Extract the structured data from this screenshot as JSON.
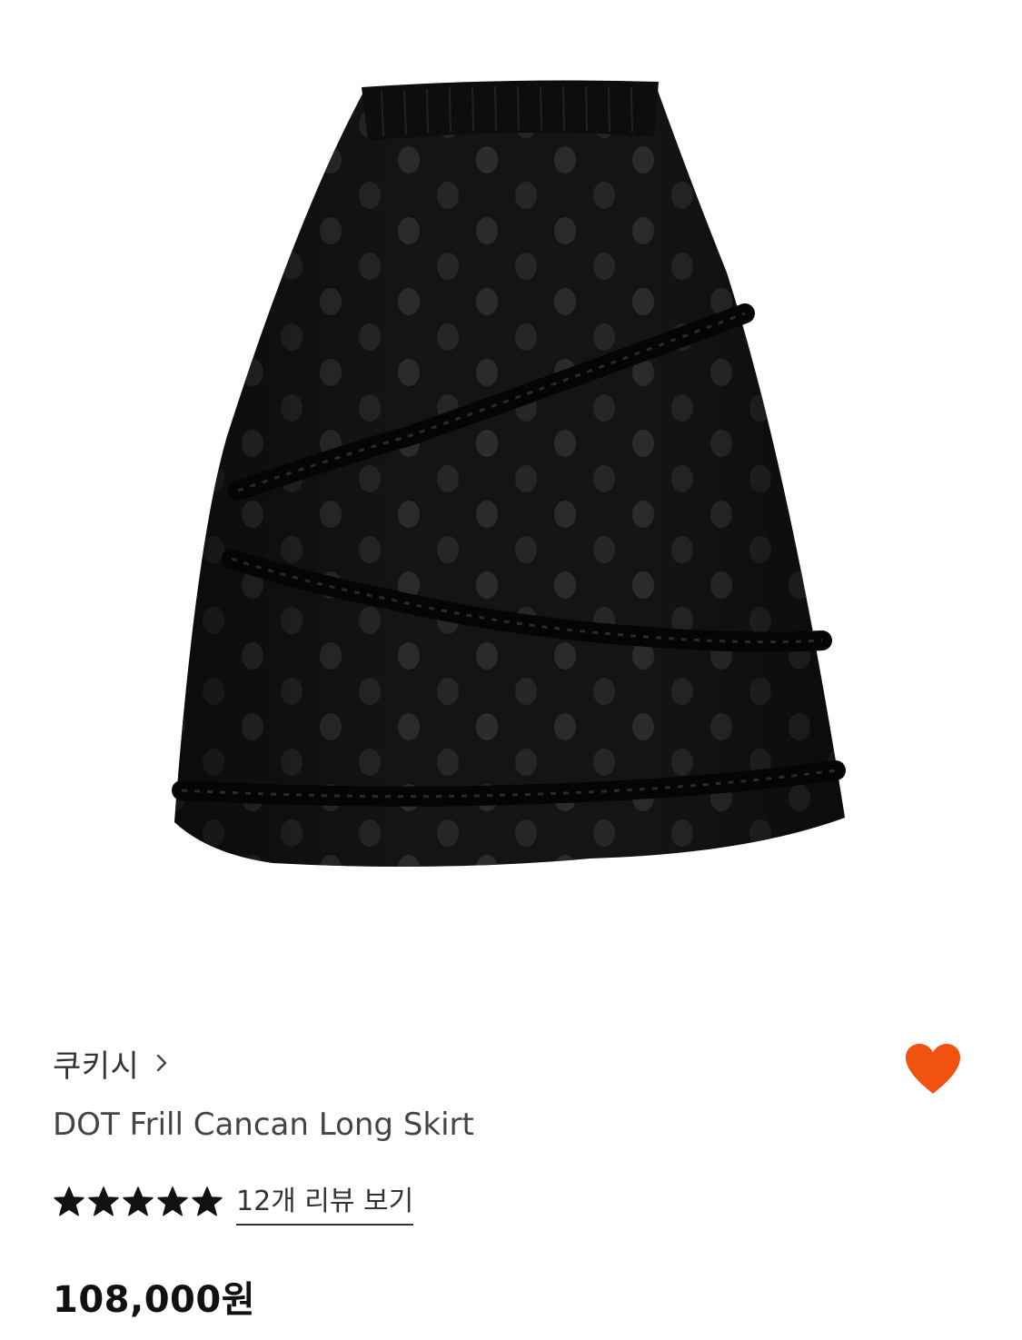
{
  "product": {
    "image_icon": "skirt-product-image",
    "brand": "쿠키시",
    "brand_chevron_icon": "chevron-right-icon",
    "name": "DOT Frill Cancan Long Skirt",
    "rating": 5,
    "rating_max": 5,
    "star_icon": "star-icon",
    "review_link": "12개 리뷰 보기",
    "price": "108,000원",
    "wishlisted": true,
    "wish_icon": "heart-icon",
    "colors": {
      "heart": "#F2520F",
      "star": "#111111",
      "skirt": "#111111"
    }
  }
}
